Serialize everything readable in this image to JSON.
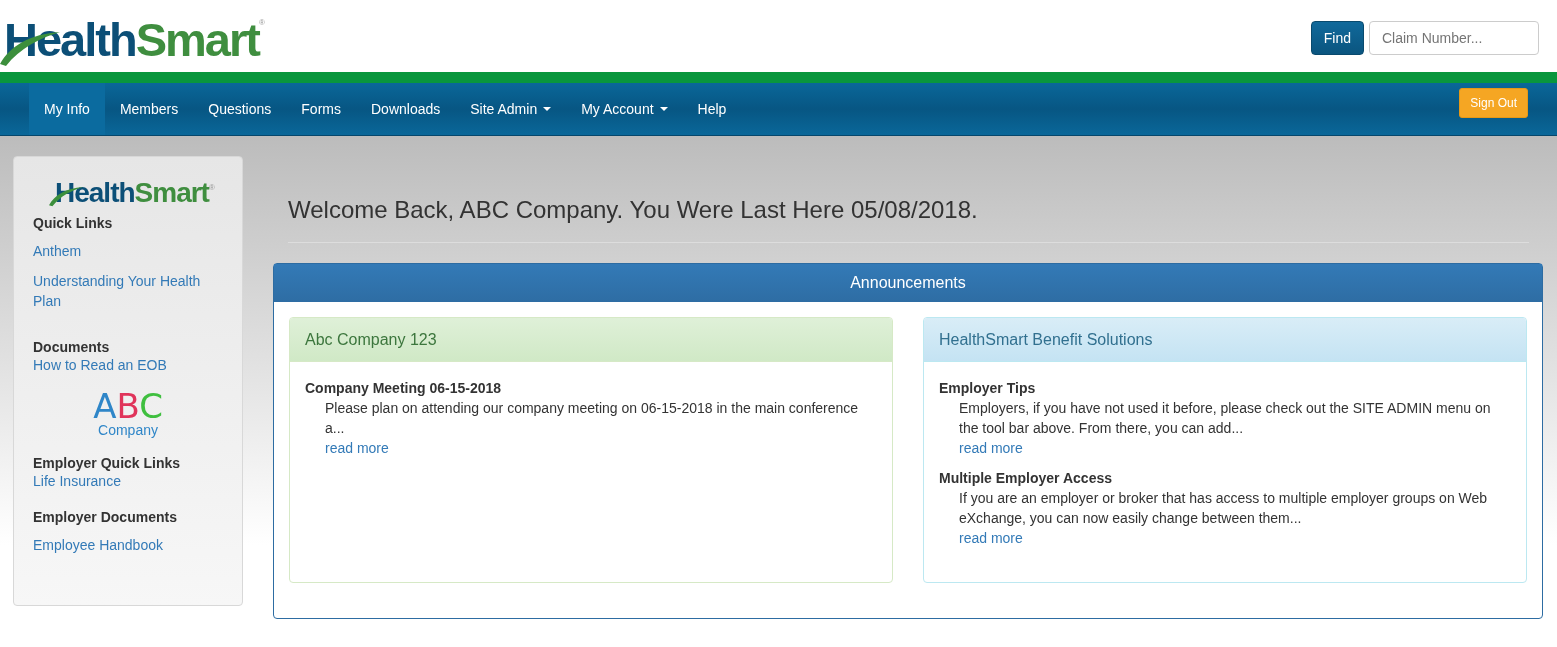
{
  "logo": {
    "first": "Health",
    "second": "Smart",
    "mark": "®"
  },
  "find": {
    "button": "Find",
    "placeholder": "Claim Number..."
  },
  "nav": [
    {
      "label": "My Info",
      "selected": true,
      "dropdown": false
    },
    {
      "label": "Members",
      "selected": false,
      "dropdown": false
    },
    {
      "label": "Questions",
      "selected": false,
      "dropdown": false
    },
    {
      "label": "Forms",
      "selected": false,
      "dropdown": false
    },
    {
      "label": "Downloads",
      "selected": false,
      "dropdown": false
    },
    {
      "label": "Site Admin",
      "selected": false,
      "dropdown": true
    },
    {
      "label": "My Account",
      "selected": false,
      "dropdown": true
    },
    {
      "label": "Help",
      "selected": false,
      "dropdown": false
    }
  ],
  "sign_out": "Sign Out",
  "sidebar": {
    "logo": {
      "first": "Health",
      "second": "Smart",
      "mark": "®"
    },
    "sections": [
      {
        "kind": "links",
        "heading": "Quick Links",
        "links": [
          "Anthem",
          "Understanding Your Health Plan"
        ]
      },
      {
        "kind": "links",
        "heading": "Documents",
        "links": [
          "How to Read an EOB"
        ]
      },
      {
        "kind": "company_logo",
        "letters": [
          "A",
          "B",
          "C"
        ],
        "word": "Company"
      },
      {
        "kind": "links",
        "heading": "Employer Quick Links",
        "links": [
          "Life Insurance"
        ]
      },
      {
        "kind": "links",
        "heading": "Employer Documents",
        "links": [
          "Employee Handbook"
        ]
      }
    ]
  },
  "welcome": "Welcome Back, ABC Company. You Were Last Here 05/08/2018.",
  "announcements": {
    "title": "Announcements",
    "panels": [
      {
        "kind": "success",
        "title": "Abc Company 123",
        "items": [
          {
            "title": "Company Meeting 06-15-2018",
            "text": "Please plan on attending our company meeting on 06-15-2018 in the main conference a...",
            "link": "read more"
          }
        ]
      },
      {
        "kind": "info",
        "title": "HealthSmart Benefit Solutions",
        "items": [
          {
            "title": "Employer Tips",
            "text": "Employers, if you have not used it before, please check out the SITE ADMIN menu on the tool bar above.  From there, you can add...",
            "link": "read more"
          },
          {
            "title": "Multiple Employer Access",
            "text": "If you are an employer or broker that has access to multiple employer groups on Web eXchange, you can now easily change between them...",
            "link": "read more"
          }
        ]
      }
    ]
  }
}
